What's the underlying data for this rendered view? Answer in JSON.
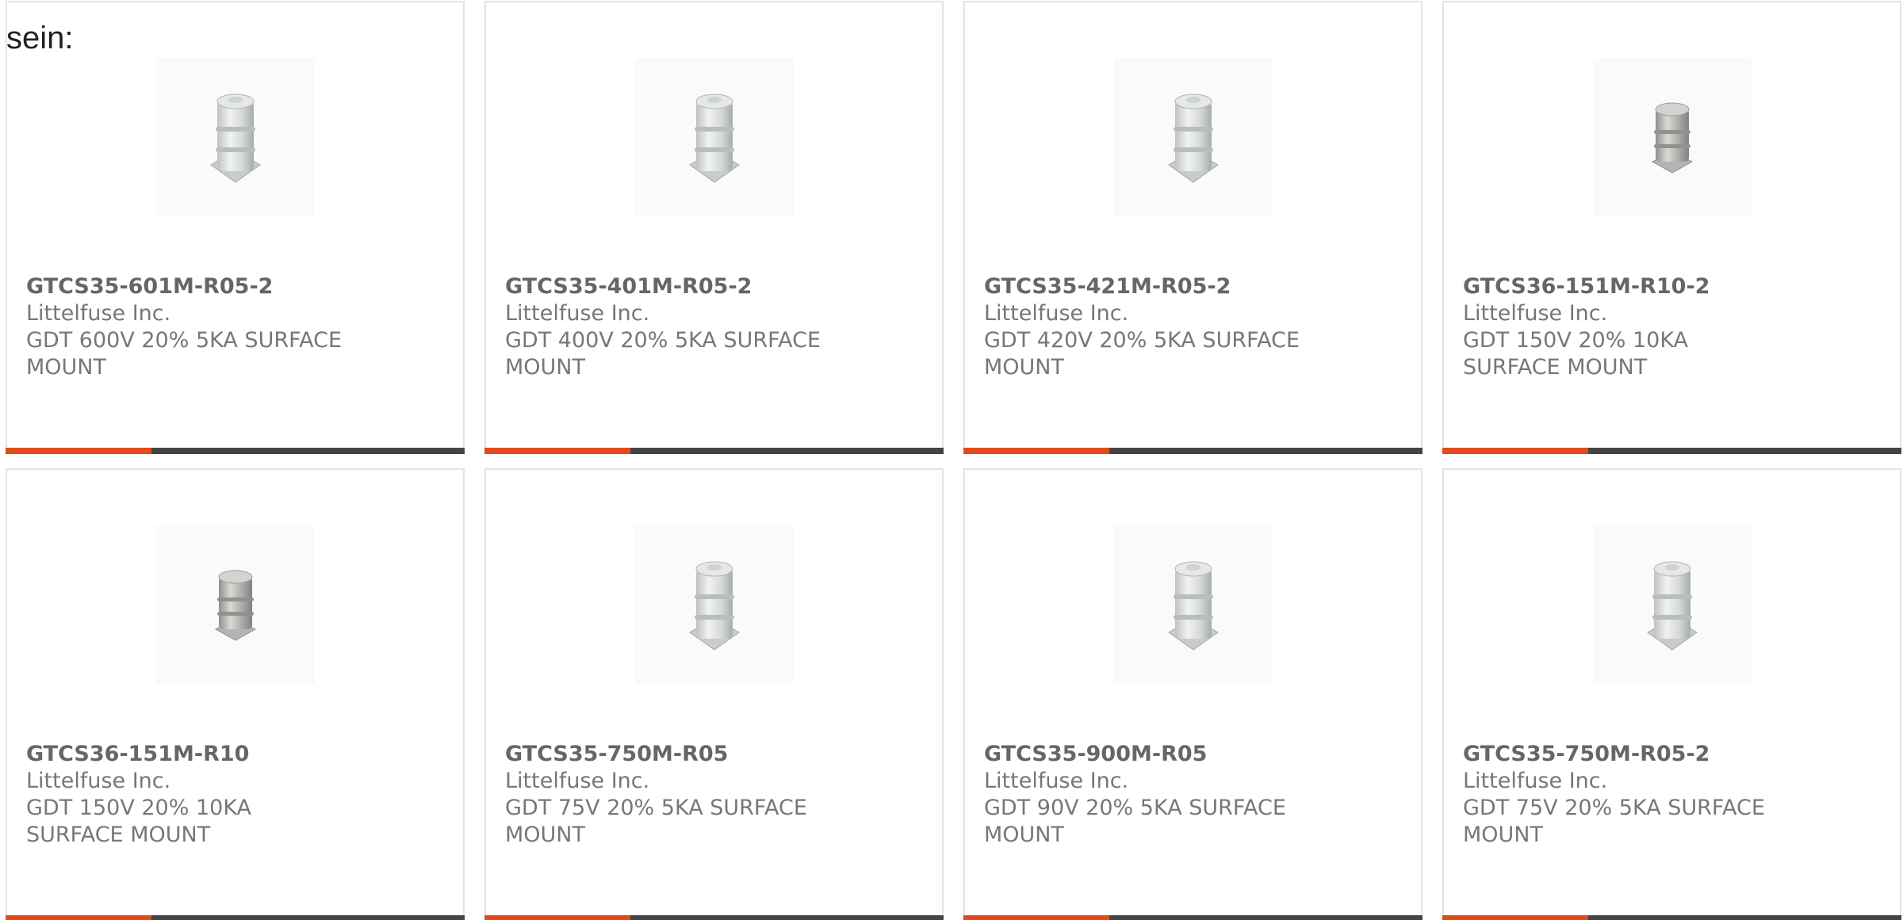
{
  "intro_text": "sein:",
  "colors": {
    "accent": "#e14a1a",
    "bar_dark": "#444444",
    "border": "#e3e3e3",
    "text": "#777777"
  },
  "products": [
    {
      "part": "GTCS35-601M-R05-2",
      "maker": "Littelfuse Inc.",
      "desc": "GDT 600V 20% 5KA SURFACE MOUNT",
      "image": "tall-gdt-image"
    },
    {
      "part": "GTCS35-401M-R05-2",
      "maker": "Littelfuse Inc.",
      "desc": "GDT 400V 20% 5KA SURFACE MOUNT",
      "image": "tall-gdt-image"
    },
    {
      "part": "GTCS35-421M-R05-2",
      "maker": "Littelfuse Inc.",
      "desc": "GDT 420V 20% 5KA SURFACE MOUNT",
      "image": "tall-gdt-image"
    },
    {
      "part": "GTCS36-151M-R10-2",
      "maker": "Littelfuse Inc.",
      "desc": "GDT 150V 20% 10KA SURFACE MOUNT",
      "image": "short-gdt-image"
    },
    {
      "part": "GTCS36-151M-R10",
      "maker": "Littelfuse Inc.",
      "desc": "GDT 150V 20% 10KA SURFACE MOUNT",
      "image": "short-gdt-image"
    },
    {
      "part": "GTCS35-750M-R05",
      "maker": "Littelfuse Inc.",
      "desc": "GDT 75V 20% 5KA SURFACE MOUNT",
      "image": "tall-gdt-image"
    },
    {
      "part": "GTCS35-900M-R05",
      "maker": "Littelfuse Inc.",
      "desc": "GDT 90V 20% 5KA SURFACE MOUNT",
      "image": "tall-gdt-image"
    },
    {
      "part": "GTCS35-750M-R05-2",
      "maker": "Littelfuse Inc.",
      "desc": "GDT 75V 20% 5KA SURFACE MOUNT",
      "image": "tall-gdt-image"
    }
  ]
}
